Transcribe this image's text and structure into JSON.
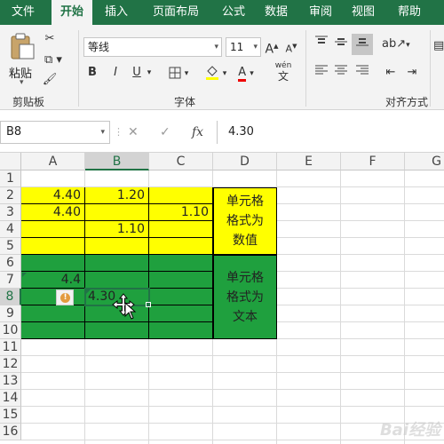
{
  "ribbon_tabs": [
    "文件",
    "开始",
    "插入",
    "页面布局",
    "公式",
    "数据",
    "审阅",
    "视图",
    "帮助"
  ],
  "active_tab": "开始",
  "clipboard": {
    "paste_label": "粘贴",
    "group_label": "剪贴板"
  },
  "font": {
    "name": "等线",
    "size": "11",
    "group_label": "字体",
    "grow": "A",
    "shrink": "A",
    "bold": "B",
    "italic": "I",
    "underline": "U",
    "phonetic": "wén"
  },
  "alignment": {
    "group_label": "对齐方式"
  },
  "formula_bar": {
    "name_box": "B8",
    "cancel": "✕",
    "enter": "✓",
    "fx": "fx",
    "value": "4.30"
  },
  "columns": [
    "A",
    "B",
    "C",
    "D",
    "E",
    "F",
    "G"
  ],
  "rows": [
    "1",
    "2",
    "3",
    "4",
    "5",
    "6",
    "7",
    "8",
    "9",
    "10",
    "11",
    "12",
    "13",
    "14",
    "15",
    "16"
  ],
  "cells": {
    "A2": "4.40",
    "B2": "1.20",
    "A3": "4.40",
    "C3": "1.10",
    "B4": "1.10",
    "A7": "4.4",
    "B8": "4.30"
  },
  "merged": {
    "D2_D5": "单元格格式为数值",
    "D6_D10": "单元格格式为文本"
  },
  "colors": {
    "excel_green": "#217346",
    "yellow_fill": "#ffff00",
    "green_fill": "#1fa03e"
  },
  "watermark": "Bai经验"
}
